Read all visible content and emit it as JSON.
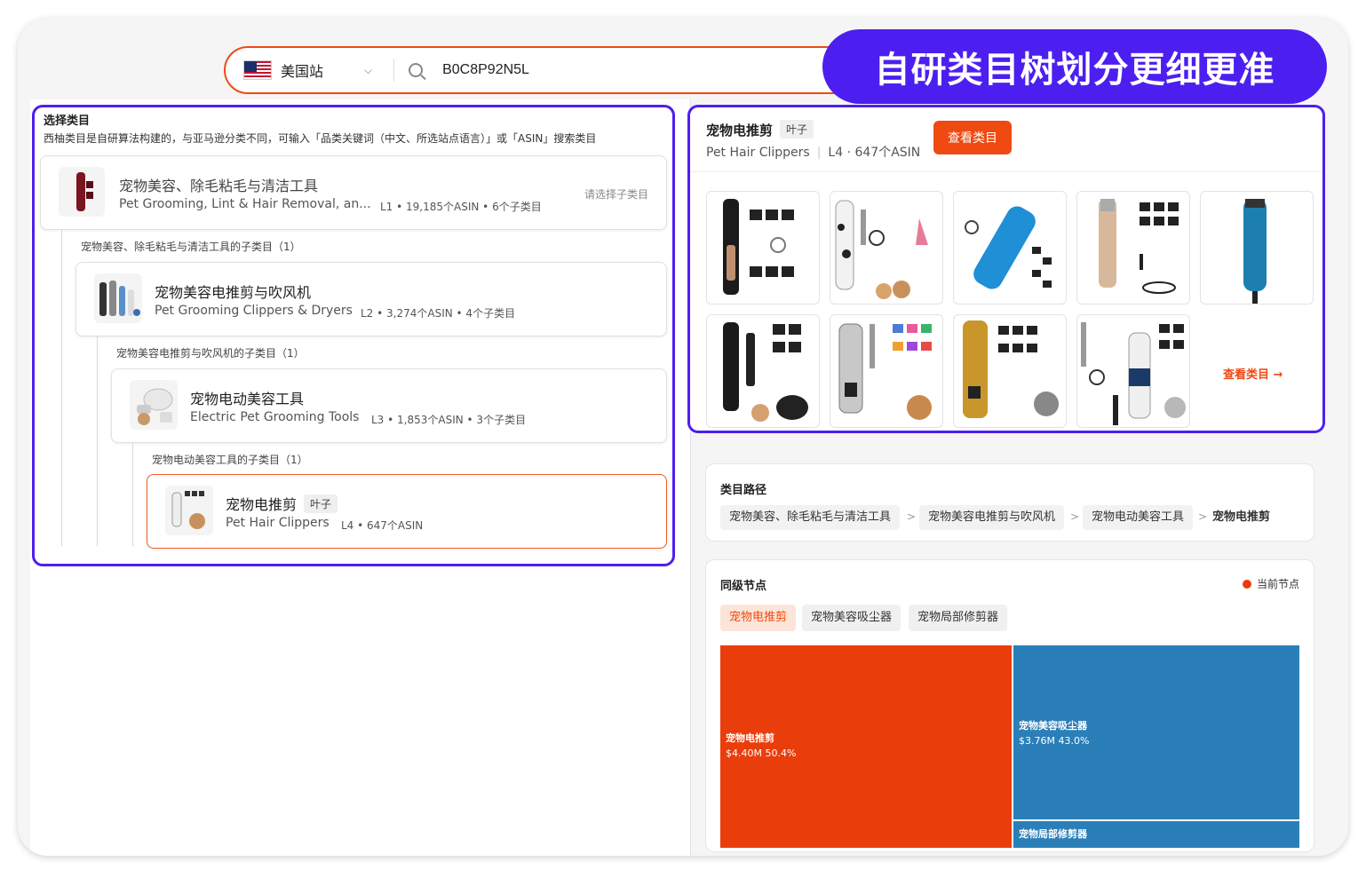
{
  "banner": {
    "text": "自研类目树划分更细更准"
  },
  "search": {
    "site": "美国站",
    "query": "B0C8P92N5L"
  },
  "left": {
    "title": "选择类目",
    "description": "西柚类目是自研算法构建的，与亚马逊分类不同，可输入「品类关键词（中文、所选站点语言）」或「ASIN」搜索类目",
    "cards": [
      {
        "cn": "宠物美容、除毛粘毛与清洁工具",
        "en": "Pet Grooming, Lint & Hair Removal, an...",
        "meta": "L1 • 19,185个ASIN • 6个子类目",
        "hint": "请选择子类目"
      },
      {
        "cn": "宠物美容电推剪与吹风机",
        "en": "Pet Grooming Clippers & Dryers",
        "meta": "L2 • 3,274个ASIN • 4个子类目"
      },
      {
        "cn": "宠物电动美容工具",
        "en": "Electric Pet Grooming Tools",
        "meta": "L3 • 1,853个ASIN • 3个子类目"
      },
      {
        "cn": "宠物电推剪",
        "leaf": "叶子",
        "en": "Pet Hair Clippers",
        "meta": "L4 • 647个ASIN"
      }
    ],
    "sublabels": [
      "宠物美容、除毛粘毛与清洁工具的子类目（1）",
      "宠物美容电推剪与吹风机的子类目（1）",
      "宠物电动美容工具的子类目（1）"
    ]
  },
  "right": {
    "cn": "宠物电推剪",
    "leaf": "叶子",
    "en": "Pet Hair Clippers",
    "meta": "L4 · 647个ASIN",
    "view_button": "查看类目",
    "view_link": "查看类目 →"
  },
  "path": {
    "title": "类目路径",
    "crumbs": [
      "宠物美容、除毛粘毛与清洁工具",
      "宠物美容电推剪与吹风机",
      "宠物电动美容工具",
      "宠物电推剪"
    ],
    "separator": ">"
  },
  "siblings": {
    "title": "同级节点",
    "legend": "当前节点",
    "chips": [
      "宠物电推剪",
      "宠物美容吸尘器",
      "宠物局部修剪器"
    ],
    "treemap": [
      {
        "name": "宠物电推剪",
        "value": "$4.40M",
        "share": "50.4%",
        "color": "#ea3d0c"
      },
      {
        "name": "宠物美容吸尘器",
        "value": "$3.76M",
        "share": "43.0%",
        "color": "#2a7fb8"
      },
      {
        "name": "宠物局部修剪器",
        "color": "#2a7fb8"
      }
    ]
  }
}
